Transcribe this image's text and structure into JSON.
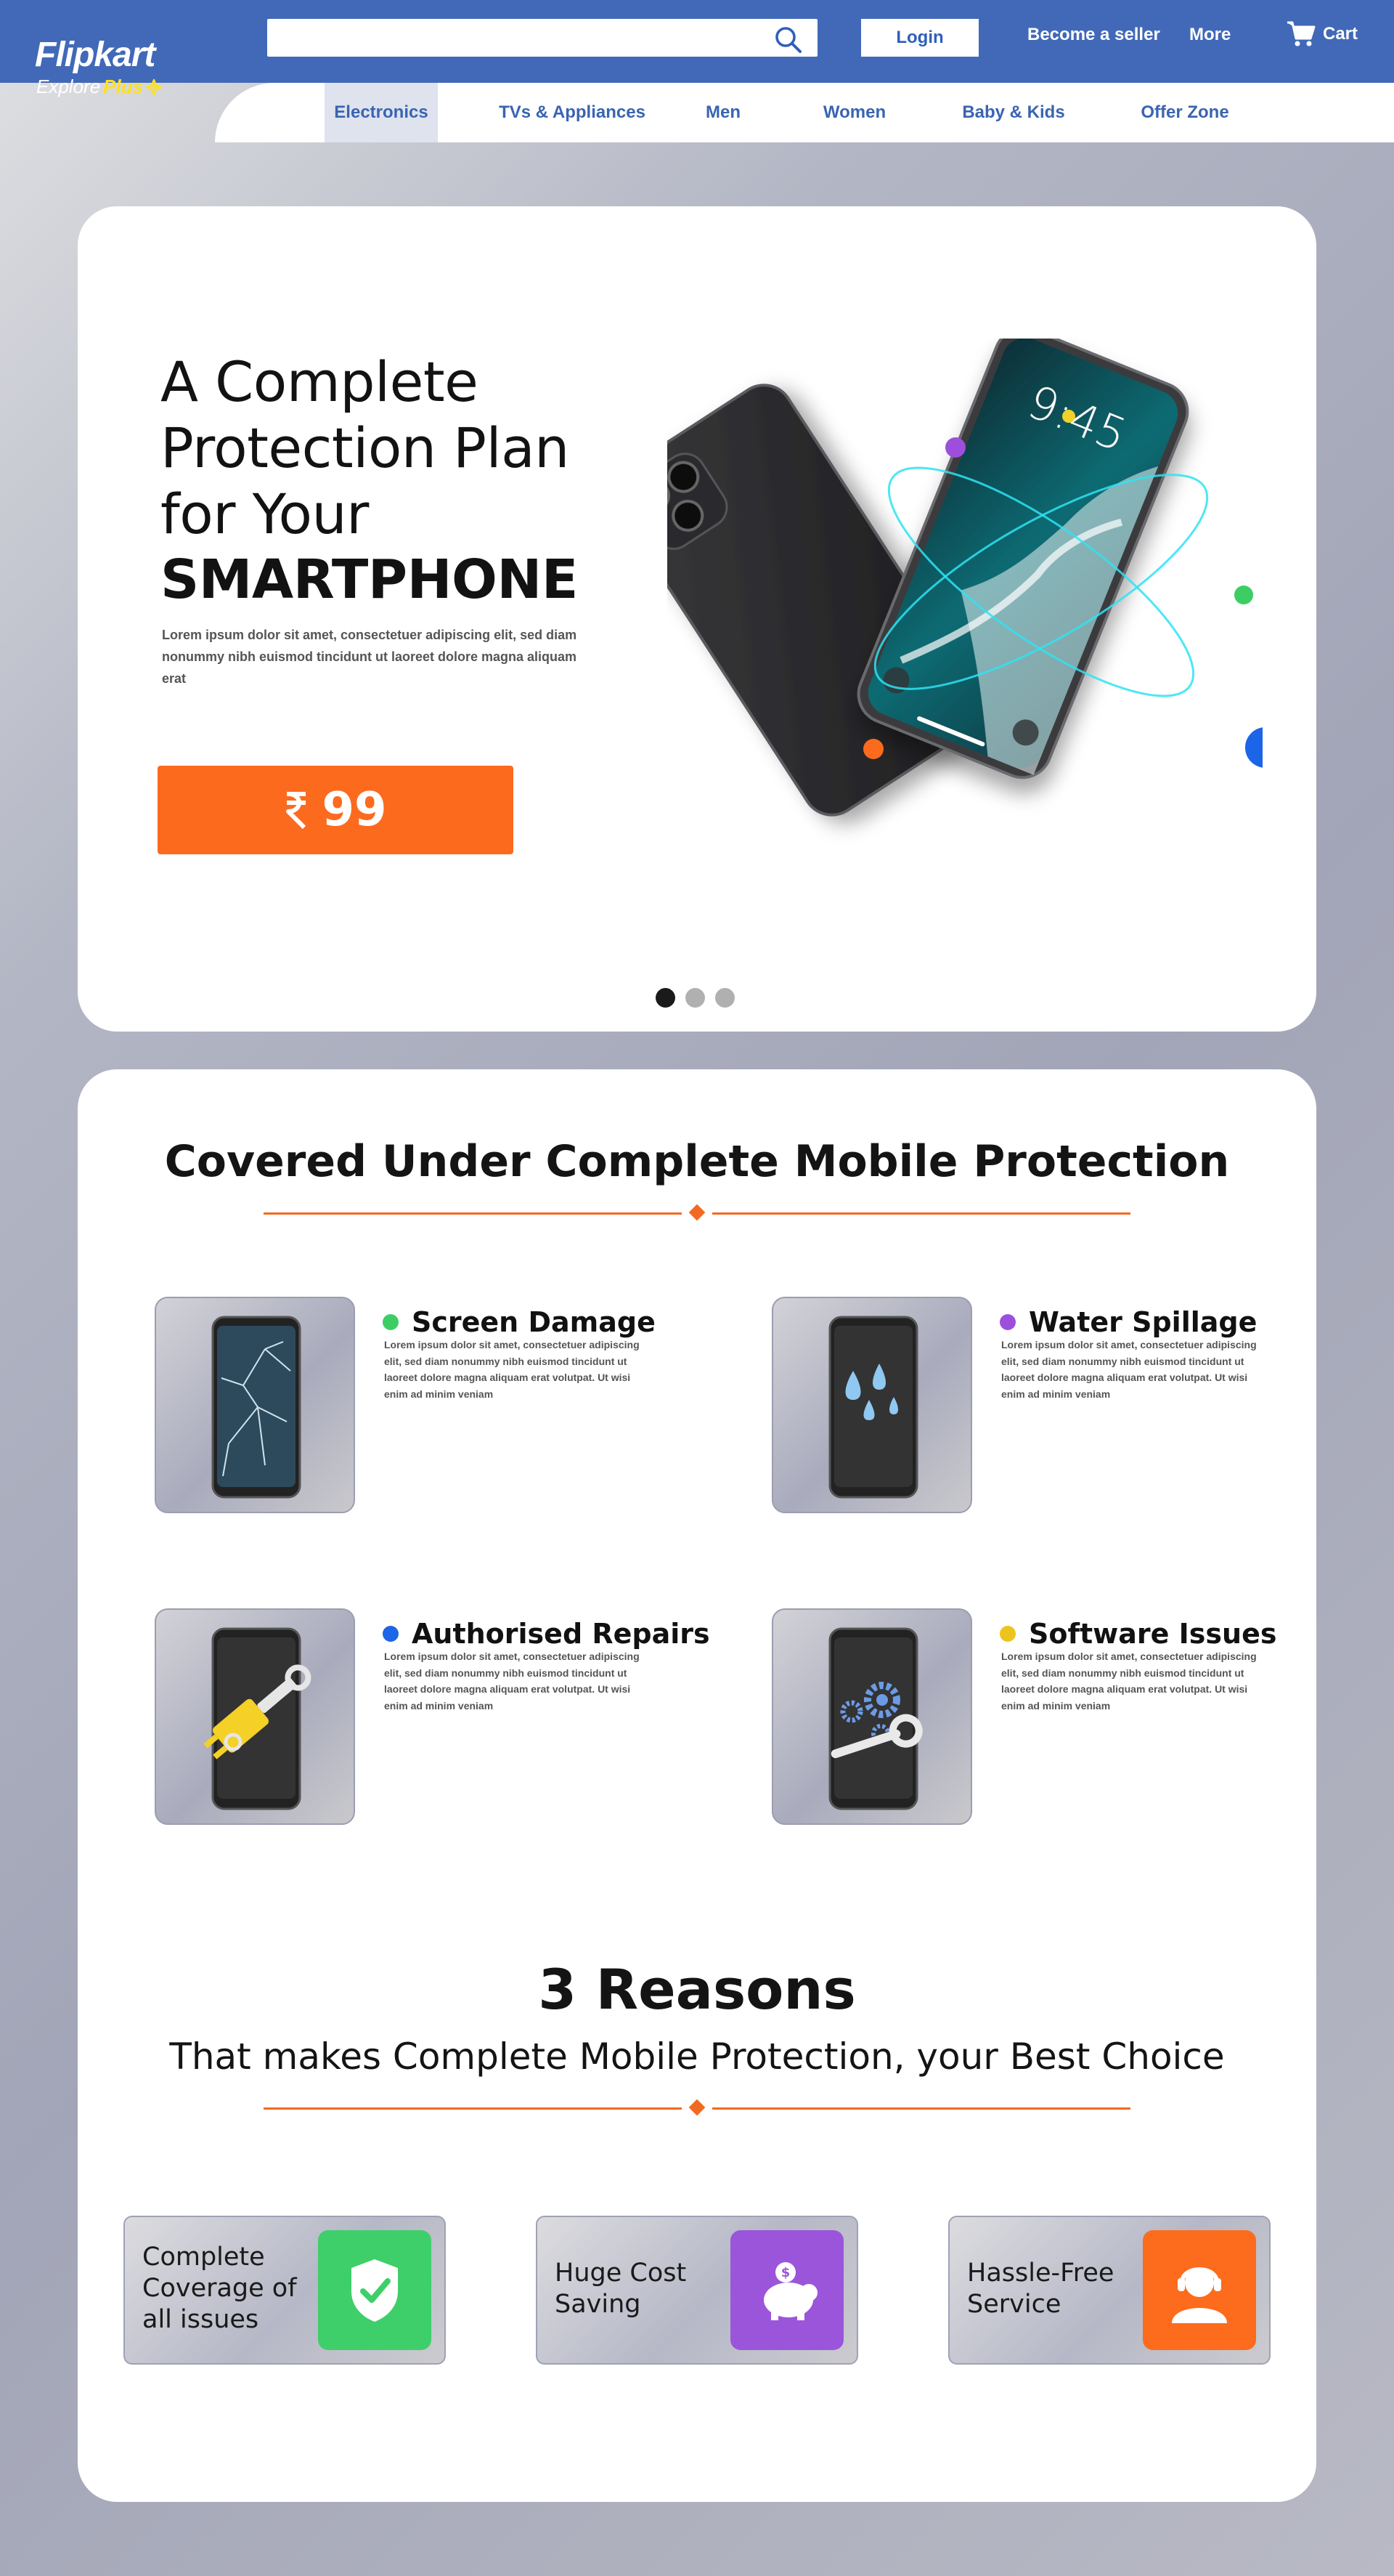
{
  "header": {
    "logo": {
      "name": "Flipkart",
      "sub": "Explore",
      "plus": "Plus"
    },
    "search_placeholder": "",
    "login_label": "Login",
    "become_seller": "Become a seller",
    "more": "More",
    "cart": "Cart"
  },
  "nav": {
    "items": [
      {
        "label": "Electronics",
        "active": true
      },
      {
        "label": "TVs & Appliances"
      },
      {
        "label": "Men"
      },
      {
        "label": "Women"
      },
      {
        "label": "Baby & Kids"
      },
      {
        "label": "Offer Zone"
      }
    ]
  },
  "hero": {
    "title_lines": [
      "A Complete",
      "Protection Plan",
      "for Your",
      "SMARTPHONE"
    ],
    "description": "Lorem ipsum dolor sit amet, consectetuer adipiscing elit, sed diam nonummy nibh euismod tincidunt ut laoreet dolore magna aliquam erat",
    "price": "99",
    "phone_time": "9:45",
    "carousel": {
      "count": 3,
      "active": 1
    }
  },
  "covered": {
    "title": "Covered Under Complete Mobile Protection",
    "features": [
      {
        "title": "Screen Damage",
        "color": "#3dcd65",
        "icon": "cracked-screen-icon",
        "text": "Lorem ipsum dolor sit amet, consectetuer adipiscing elit, sed diam nonummy nibh euismod tincidunt ut laoreet dolore magna aliquam erat volutpat. Ut wisi enim ad minim veniam"
      },
      {
        "title": "Water Spillage",
        "color": "#9c4fdc",
        "icon": "water-drops-icon",
        "text": "Lorem ipsum dolor sit amet, consectetuer adipiscing elit, sed diam nonummy nibh euismod tincidunt ut laoreet dolore magna aliquam erat volutpat. Ut wisi enim ad minim veniam"
      },
      {
        "title": "Authorised Repairs",
        "color": "#1c64e8",
        "icon": "repair-tools-icon",
        "text": "Lorem ipsum dolor sit amet, consectetuer adipiscing elit, sed diam nonummy nibh euismod tincidunt ut laoreet dolore magna aliquam erat volutpat. Ut wisi enim ad minim veniam"
      },
      {
        "title": "Software Issues",
        "color": "#ebc51e",
        "icon": "gears-wrench-icon",
        "text": "Lorem ipsum dolor sit amet, consectetuer adipiscing elit, sed diam nonummy nibh euismod tincidunt ut laoreet dolore magna aliquam erat volutpat. Ut wisi enim ad minim veniam"
      }
    ]
  },
  "reasons": {
    "title": "3 Reasons",
    "subtitle": "That makes Complete Mobile Protection, your Best Choice",
    "items": [
      {
        "lines": [
          "Complete",
          "Coverage of",
          "all issues"
        ],
        "color": "#3ecf6a",
        "icon": "shield-check-icon"
      },
      {
        "lines": [
          "Huge Cost",
          "Saving"
        ],
        "color": "#9b55db",
        "icon": "piggy-bank-icon"
      },
      {
        "lines": [
          "Hassle-Free",
          "Service"
        ],
        "color": "#fd6b1c",
        "icon": "support-agent-icon"
      }
    ]
  },
  "colors": {
    "header_blue": "#4169b8",
    "nav_text": "#3a64b2",
    "accent_orange": "#fc6a1e",
    "divider_orange": "#f26a22"
  }
}
